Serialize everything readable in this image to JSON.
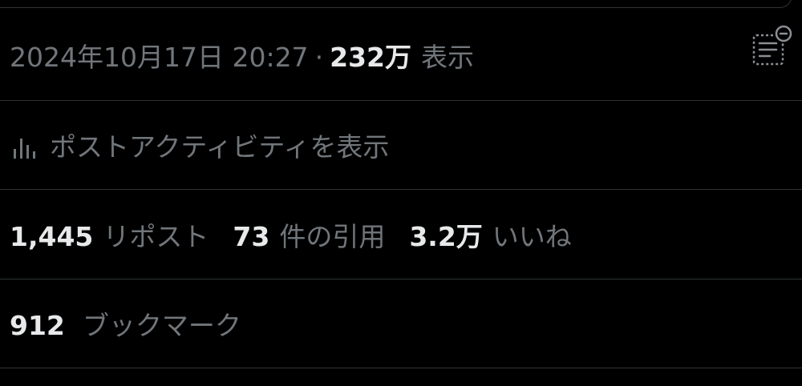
{
  "post_meta": {
    "timestamp": "2024年10月17日 20:27",
    "separator": "·",
    "views_count": "232万",
    "views_label": "表示"
  },
  "activity": {
    "label": "ポストアクティビティを表示",
    "icon": "bar-chart-icon"
  },
  "engagements": {
    "reposts_count": "1,445",
    "reposts_label": "リポスト",
    "quotes_count": "73",
    "quotes_label": "件の引用",
    "likes_count": "3.2万",
    "likes_label": "いいね"
  },
  "bookmarks": {
    "count": "912",
    "label": "ブックマーク"
  },
  "colors": {
    "background": "#000000",
    "primary_text": "#e7e9ea",
    "secondary_text": "#71767b",
    "divider": "#2f3336"
  }
}
